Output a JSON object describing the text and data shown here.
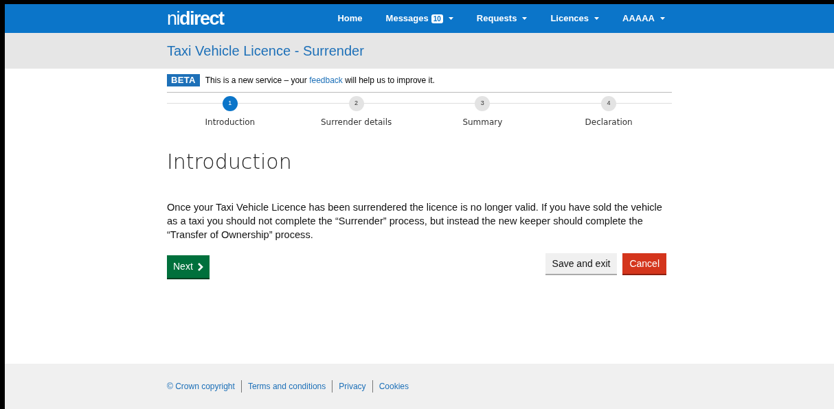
{
  "header": {
    "logo": "ni**direct**",
    "nav": [
      {
        "label": "Home",
        "dropdown": false
      },
      {
        "label": "Messages",
        "badge": "10",
        "dropdown": true
      },
      {
        "label": "Requests",
        "dropdown": true
      },
      {
        "label": "Licences",
        "dropdown": true
      },
      {
        "label": "AAAAA",
        "dropdown": true
      }
    ]
  },
  "page_title": "Taxi Vehicle Licence - Surrender",
  "beta": {
    "tag": "BETA",
    "before": "This is a new service – your",
    "link": "feedback",
    "after": "will help us to improve it."
  },
  "steps": [
    {
      "number": "1",
      "label": "Introduction",
      "selected": true
    },
    {
      "number": "2",
      "label": "Surrender details",
      "selected": false
    },
    {
      "number": "3",
      "label": "Summary",
      "selected": false
    },
    {
      "number": "4",
      "label": "Declaration",
      "selected": false
    }
  ],
  "heading": "Introduction",
  "body": "Once your Taxi Vehicle Licence has been surrendered the licence is no longer valid. If you have sold the vehicle as a taxi you should not complete the “Surrender” process, but instead the new keeper should complete the “Transfer of Ownership” process.",
  "buttons": {
    "next": "Next",
    "save": "Save and exit",
    "cancel": "Cancel"
  },
  "footer": [
    "© Crown copyright",
    "Terms and conditions",
    "Privacy",
    "Cookies"
  ]
}
